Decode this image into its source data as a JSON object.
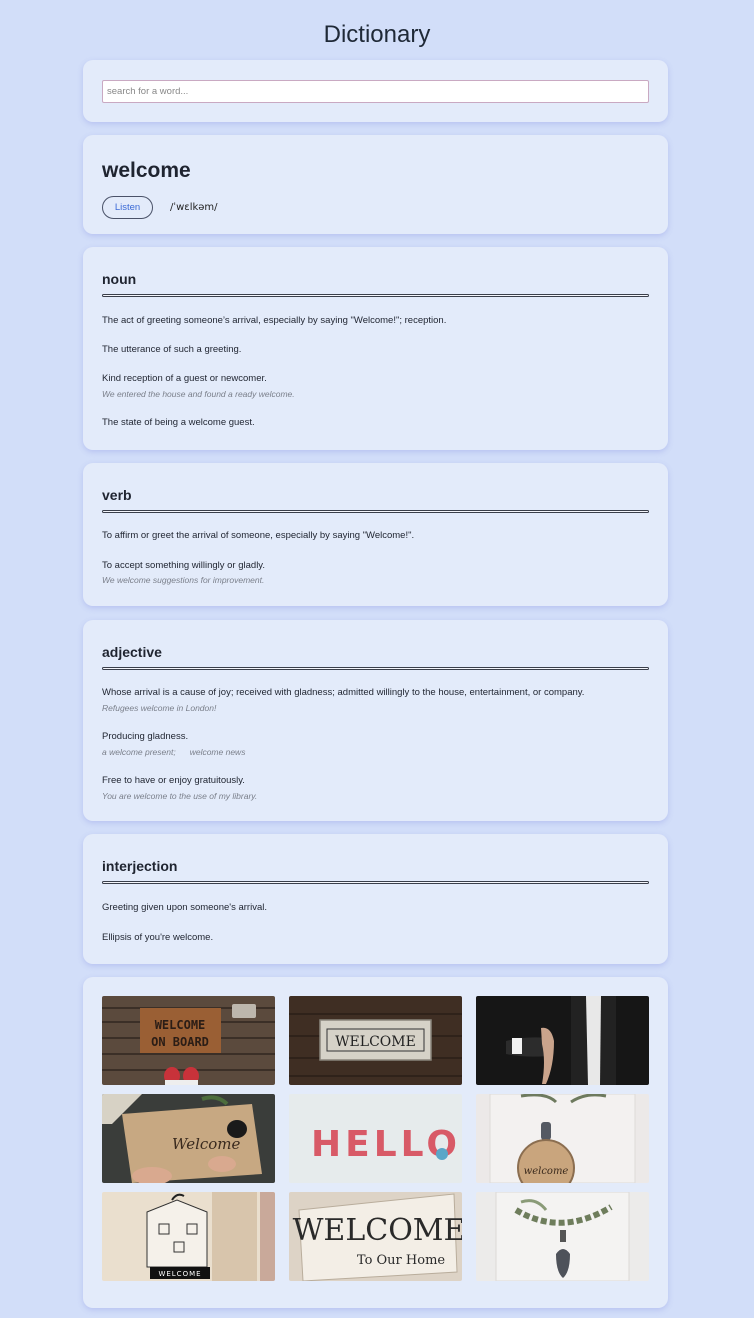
{
  "app": {
    "title": "Dictionary"
  },
  "search": {
    "placeholder": "search for a word..."
  },
  "entry": {
    "word": "welcome",
    "listen_label": "Listen",
    "phonetic": "/ˈwɛlkəm/"
  },
  "meanings": {
    "noun": {
      "part_of_speech": "noun",
      "definitions": [
        {
          "text": "The act of greeting someone’s arrival, especially by saying \"Welcome!\"; reception."
        },
        {
          "text": "The utterance of such a greeting."
        },
        {
          "text": "Kind reception of a guest or newcomer.",
          "example": "We entered the house and found a ready welcome."
        },
        {
          "text": "The state of being a welcome guest."
        }
      ]
    },
    "verb": {
      "part_of_speech": "verb",
      "definitions": [
        {
          "text": "To affirm or greet the arrival of someone, especially by saying \"Welcome!\"."
        },
        {
          "text": "To accept something willingly or gladly.",
          "example": "We welcome suggestions for improvement."
        }
      ]
    },
    "adjective": {
      "part_of_speech": "adjective",
      "definitions": [
        {
          "text": "Whose arrival is a cause of joy; received with gladness; admitted willingly to the house, entertainment, or company.",
          "example": "Refugees welcome in London!"
        },
        {
          "text": "Producing gladness.",
          "examples": [
            "a welcome present;",
            "welcome news"
          ]
        },
        {
          "text": "Free to have or enjoy gratuitously.",
          "example": "You are welcome to the use of my library."
        }
      ]
    },
    "interjection": {
      "part_of_speech": "interjection",
      "definitions": [
        {
          "text": "Greeting given upon someone's arrival."
        },
        {
          "text": "Ellipsis of you're welcome."
        }
      ]
    }
  },
  "images": {
    "doormat": {
      "text_line1": "WELCOME",
      "text_line2": "ON BOARD"
    },
    "wood_sign": {
      "text": "WELCOME"
    },
    "handwriting": {
      "text": "Welcome"
    },
    "hello_letters": {
      "text": "HELLO"
    },
    "door_plaque": {
      "text": "welcome"
    },
    "house_sketch": {
      "text": "WELCOME"
    },
    "home_sign": {
      "text_line1": "WELCOME",
      "text_line2": "To Our Home"
    }
  },
  "colors": {
    "page_background": "#d2def9",
    "card_background": "#e3ebfa",
    "accent_link": "#3b6ad6",
    "example_text": "#7a7f8a"
  }
}
